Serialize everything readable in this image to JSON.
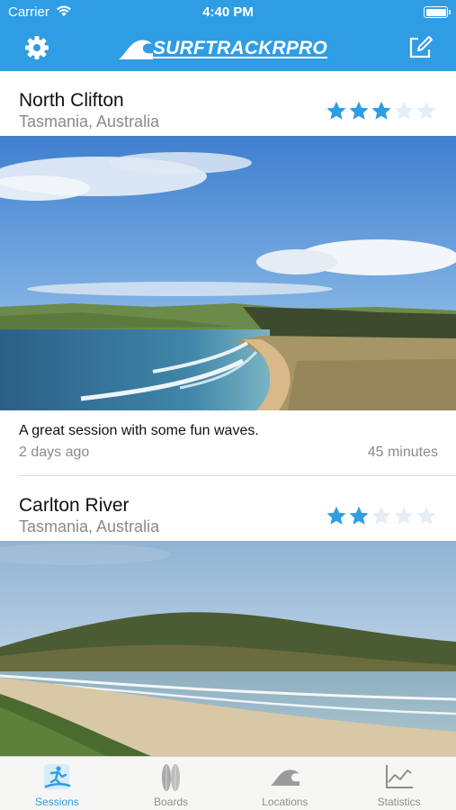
{
  "status": {
    "carrier": "Carrier",
    "time": "4:40 PM"
  },
  "header": {
    "logo_main": "SURFTRACKR",
    "logo_pro": "PRO"
  },
  "sessions": [
    {
      "name": "North Clifton",
      "location": "Tasmania, Australia",
      "rating": 3,
      "max_rating": 5,
      "note": "A great session with some fun waves.",
      "ago": "2 days ago",
      "duration": "45 minutes"
    },
    {
      "name": "Carlton River",
      "location": "Tasmania, Australia",
      "rating": 2,
      "max_rating": 5
    }
  ],
  "tabs": [
    {
      "label": "Sessions",
      "icon": "surfer-icon",
      "active": true
    },
    {
      "label": "Boards",
      "icon": "surfboards-icon",
      "active": false
    },
    {
      "label": "Locations",
      "icon": "wave-icon",
      "active": false
    },
    {
      "label": "Statistics",
      "icon": "line-chart-icon",
      "active": false
    }
  ],
  "colors": {
    "accent": "#2f9de3",
    "star_on": "#2f9de3",
    "star_off": "#e6eef5",
    "tab_inactive": "#8e8e8e"
  }
}
